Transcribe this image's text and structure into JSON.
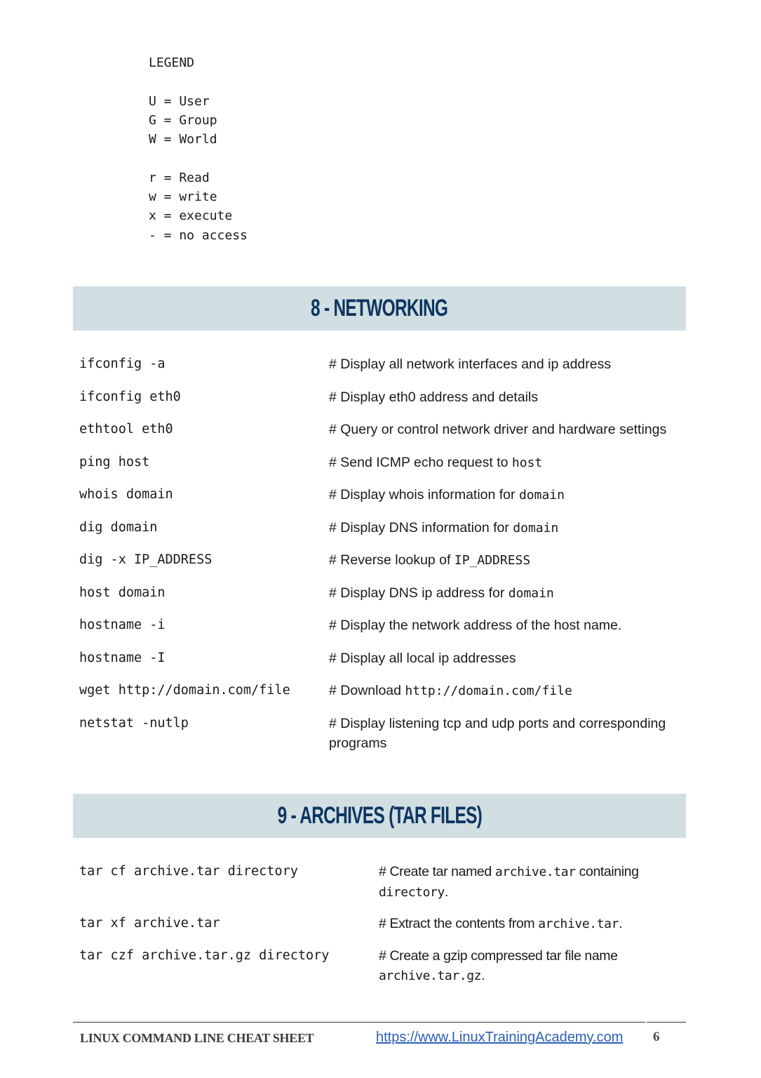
{
  "legend": {
    "title": "LEGEND",
    "lines": [
      "U = User",
      "G = Group",
      "W = World",
      "",
      "r = Read",
      "w = write",
      "x = execute",
      "- = no access"
    ]
  },
  "networking": {
    "title": "8 - NETWORKING",
    "rows": [
      {
        "cmd": "ifconfig -a",
        "desc": "# Display all network interfaces and ip address",
        "code": ""
      },
      {
        "cmd": "ifconfig eth0",
        "desc": "# Display eth0 address and details",
        "code": ""
      },
      {
        "cmd": "ethtool eth0",
        "desc": "# Query or control network driver and hardware settings",
        "code": ""
      },
      {
        "cmd": "ping host",
        "desc": "# Send ICMP echo request to ",
        "code": "host"
      },
      {
        "cmd": "whois domain",
        "desc": "# Display whois information for ",
        "code": "domain"
      },
      {
        "cmd": "dig domain",
        "desc": "# Display DNS information for ",
        "code": "domain"
      },
      {
        "cmd": "dig -x IP_ADDRESS",
        "desc": "# Reverse lookup of ",
        "code": "IP_ADDRESS"
      },
      {
        "cmd": "host domain",
        "desc": "# Display DNS ip address for ",
        "code": "domain"
      },
      {
        "cmd": "hostname -i",
        "desc": "# Display the network address of the host name.",
        "code": ""
      },
      {
        "cmd": "hostname -I",
        "desc": "# Display all local ip addresses",
        "code": ""
      },
      {
        "cmd": "wget http://domain.com/file",
        "desc": "# Download ",
        "code": "http://domain.com/file"
      },
      {
        "cmd": "netstat -nutlp",
        "desc": "# Display listening tcp and udp ports and corresponding programs",
        "code": ""
      }
    ]
  },
  "archives": {
    "title": "9 - ARCHIVES (TAR FILES)",
    "rows": [
      {
        "cmd": "tar cf archive.tar directory",
        "desc_parts": [
          "# Create tar named ",
          "archive.tar",
          " containing ",
          "directory",
          "."
        ]
      },
      {
        "cmd": "tar xf archive.tar",
        "desc_parts": [
          "# Extract the contents from ",
          "archive.tar",
          "."
        ]
      },
      {
        "cmd": "tar czf archive.tar.gz directory",
        "desc_parts": [
          "# Create a gzip compressed tar file name ",
          "archive.tar.gz",
          "."
        ]
      }
    ]
  },
  "footer": {
    "title": "LINUX COMMAND LINE CHEAT SHEET",
    "link": "https://www.LinuxTrainingAcademy.com",
    "page": "6"
  }
}
